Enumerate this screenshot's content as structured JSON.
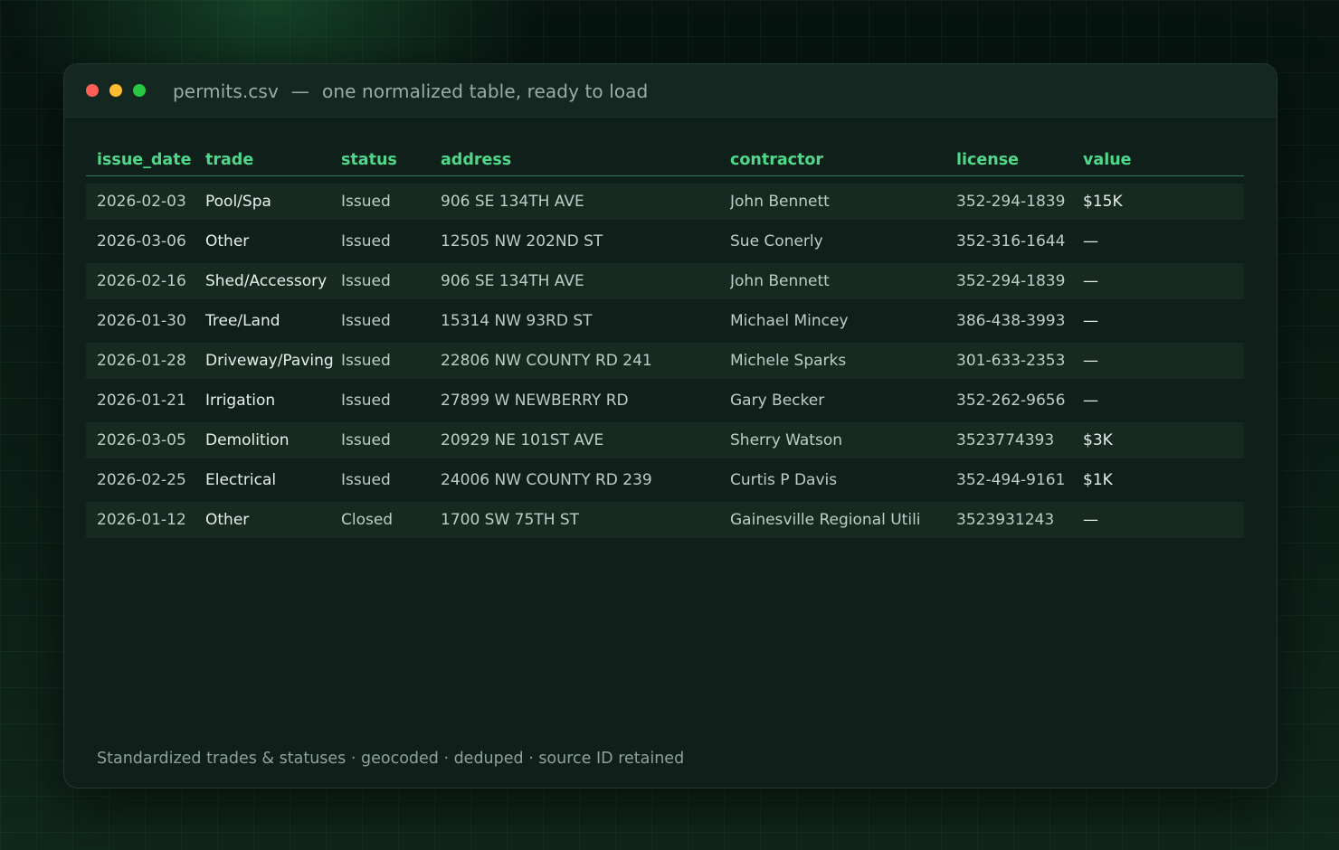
{
  "window": {
    "filename": "permits.csv",
    "separator": "—",
    "subtitle": "one normalized table, ready to load"
  },
  "colors": {
    "accent": "#4fd88a",
    "light_red": "#ff5f57",
    "light_yellow": "#febc2e",
    "light_green": "#28c840"
  },
  "table": {
    "headers": [
      "issue_date",
      "trade",
      "status",
      "address",
      "contractor",
      "license",
      "value"
    ],
    "rows": [
      [
        "2026-02-03",
        "Pool/Spa",
        "Issued",
        "906 SE 134TH AVE",
        "John Bennett",
        "352-294-1839",
        "$15K"
      ],
      [
        "2026-03-06",
        "Other",
        "Issued",
        "12505 NW 202ND ST",
        "Sue Conerly",
        "352-316-1644",
        "—"
      ],
      [
        "2026-02-16",
        "Shed/Accessory",
        "Issued",
        "906 SE 134TH AVE",
        "John Bennett",
        "352-294-1839",
        "—"
      ],
      [
        "2026-01-30",
        "Tree/Land",
        "Issued",
        "15314 NW 93RD ST",
        "Michael Mincey",
        "386-438-3993",
        "—"
      ],
      [
        "2026-01-28",
        "Driveway/Paving",
        "Issued",
        "22806 NW COUNTY RD 241",
        "Michele Sparks",
        "301-633-2353",
        "—"
      ],
      [
        "2026-01-21",
        "Irrigation",
        "Issued",
        "27899 W NEWBERRY RD",
        "Gary Becker",
        "352-262-9656",
        "—"
      ],
      [
        "2026-03-05",
        "Demolition",
        "Issued",
        "20929 NE 101ST AVE",
        "Sherry Watson",
        "3523774393",
        "$3K"
      ],
      [
        "2026-02-25",
        "Electrical",
        "Issued",
        "24006 NW COUNTY RD 239",
        "Curtis P Davis",
        "352-494-9161",
        "$1K"
      ],
      [
        "2026-01-12",
        "Other",
        "Closed",
        "1700 SW 75TH ST",
        "Gainesville Regional Utili",
        "3523931243",
        "—"
      ]
    ]
  },
  "footer": {
    "text": "Standardized trades & statuses · geocoded · deduped · source ID retained"
  }
}
